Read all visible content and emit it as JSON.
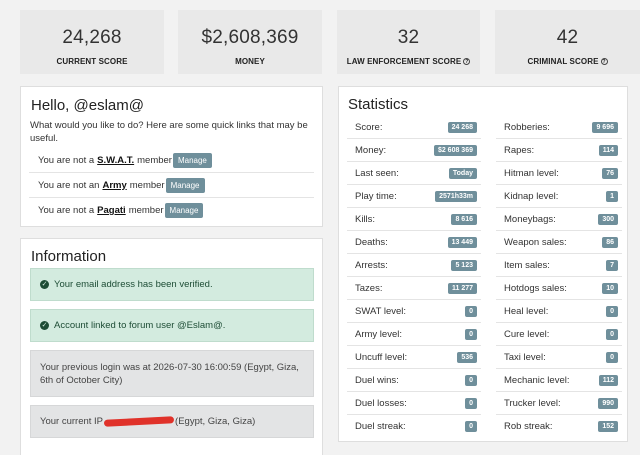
{
  "cards": [
    {
      "value": "24,268",
      "label": "CURRENT SCORE",
      "help": false
    },
    {
      "value": "$2,608,369",
      "label": "MONEY",
      "help": false
    },
    {
      "value": "32",
      "label": "LAW ENFORCEMENT SCORE",
      "help": true
    },
    {
      "value": "42",
      "label": "CRIMINAL SCORE",
      "help": true
    }
  ],
  "hello": {
    "title": "Hello, @eslam@",
    "intro": "What would you like to do? Here are some quick links that may be useful.",
    "members": [
      {
        "prefix": "You are not a",
        "group": "S.W.A.T.",
        "suffix": "member",
        "button": "Manage"
      },
      {
        "prefix": "You are not an",
        "group": "Army",
        "suffix": "member",
        "button": "Manage"
      },
      {
        "prefix": "You are not a",
        "group": "Pagati",
        "suffix": "member",
        "button": "Manage"
      }
    ]
  },
  "information": {
    "title": "Information",
    "email_verified": "Your email address has been verified.",
    "forum_linked": "Account linked to forum user @Eslam@.",
    "previous_login": "Your previous login was at 2026-07-30 16:00:59 (Egypt, Giza, 6th of October City)",
    "current_ip_prefix": "Your current IP",
    "current_ip_suffix": "(Egypt, Giza, Giza)"
  },
  "statistics": {
    "title": "Statistics",
    "left": [
      {
        "label": "Score:",
        "value": "24 268"
      },
      {
        "label": "Money:",
        "value": "$2 608 369"
      },
      {
        "label": "Last seen:",
        "value": "Today"
      },
      {
        "label": "Play time:",
        "value": "2571h33m"
      },
      {
        "label": "Kills:",
        "value": "8 616"
      },
      {
        "label": "Deaths:",
        "value": "13 449"
      },
      {
        "label": "Arrests:",
        "value": "5 123"
      },
      {
        "label": "Tazes:",
        "value": "11 277"
      },
      {
        "label": "SWAT level:",
        "value": "0"
      },
      {
        "label": "Army level:",
        "value": "0"
      },
      {
        "label": "Uncuff level:",
        "value": "536"
      },
      {
        "label": "Duel wins:",
        "value": "0"
      },
      {
        "label": "Duel losses:",
        "value": "0"
      },
      {
        "label": "Duel streak:",
        "value": "0"
      }
    ],
    "right": [
      {
        "label": "Robberies:",
        "value": "9 696"
      },
      {
        "label": "Rapes:",
        "value": "114"
      },
      {
        "label": "Hitman level:",
        "value": "76"
      },
      {
        "label": "Kidnap level:",
        "value": "1"
      },
      {
        "label": "Moneybags:",
        "value": "300"
      },
      {
        "label": "Weapon sales:",
        "value": "86"
      },
      {
        "label": "Item sales:",
        "value": "7"
      },
      {
        "label": "Hotdogs sales:",
        "value": "10"
      },
      {
        "label": "Heal level:",
        "value": "0"
      },
      {
        "label": "Cure level:",
        "value": "0"
      },
      {
        "label": "Taxi level:",
        "value": "0"
      },
      {
        "label": "Mechanic level:",
        "value": "112"
      },
      {
        "label": "Trucker level:",
        "value": "990"
      },
      {
        "label": "Rob streak:",
        "value": "152"
      }
    ]
  },
  "colors": {
    "badge": "#6f8f9b",
    "success_bg": "#d3ebdf",
    "neutral_bg": "#e3e4e5",
    "redaction": "#e0322a"
  },
  "icons": {
    "help": "question-circle-icon",
    "success": "check-circle-icon"
  }
}
